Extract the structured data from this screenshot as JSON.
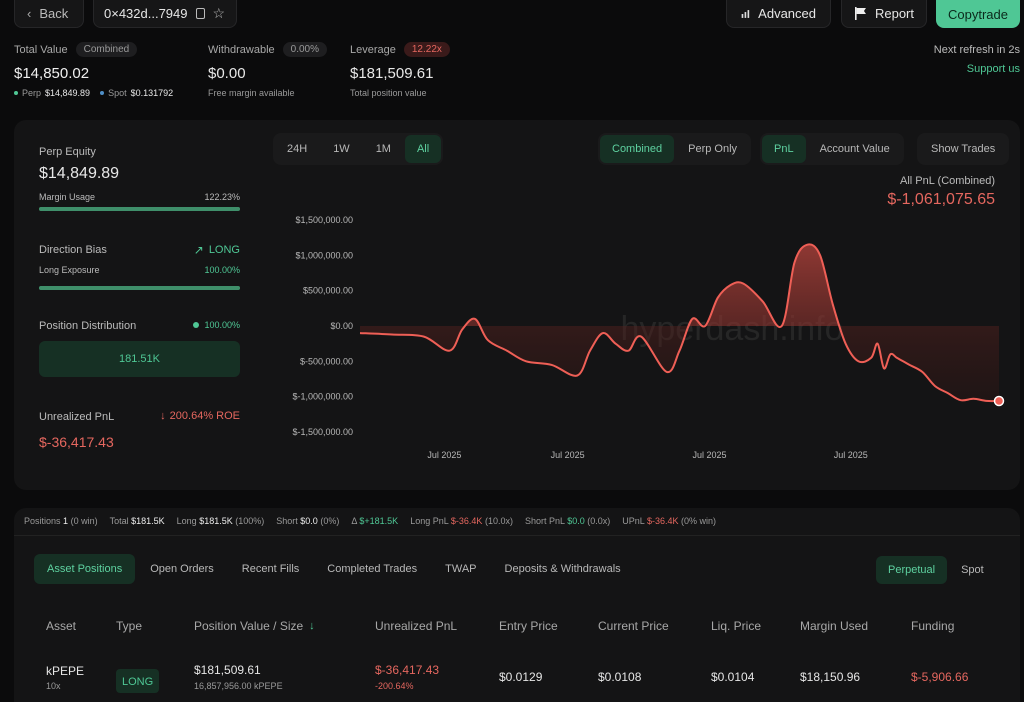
{
  "topbar": {
    "back_label": "Back",
    "address": "0×432d...7949",
    "advanced_label": "Advanced",
    "report_label": "Report",
    "copytrade_label": "Copytrade"
  },
  "summary": {
    "total_value_label": "Total Value",
    "total_value_badge": "Combined",
    "total_value": "$14,850.02",
    "perp_label": "Perp",
    "perp_value": "$14,849.89",
    "spot_label": "Spot",
    "spot_value": "$0.131792",
    "withdrawable_label": "Withdrawable",
    "withdrawable_badge": "0.00%",
    "withdrawable_value": "$0.00",
    "withdrawable_sub": "Free margin available",
    "leverage_label": "Leverage",
    "leverage_badge": "12.22x",
    "leverage_value": "$181,509.61",
    "leverage_sub": "Total position value",
    "refresh_text": "Next refresh in 2s",
    "support_label": "Support us"
  },
  "left_panel": {
    "perp_equity_label": "Perp Equity",
    "perp_equity_value": "$14,849.89",
    "margin_usage_label": "Margin Usage",
    "margin_usage_value": "122.23%",
    "direction_bias_label": "Direction Bias",
    "direction_bias_value": "LONG",
    "long_exposure_label": "Long Exposure",
    "long_exposure_value": "100.00%",
    "position_distribution_label": "Position Distribution",
    "position_distribution_value": "100.00%",
    "distribution_box_value": "181.51K",
    "unrealized_label": "Unrealized PnL",
    "roe_value": "200.64% ROE",
    "unrealized_value": "$-36,417.43",
    "margin_usage_fraction": 1.0,
    "long_exposure_fraction": 1.0
  },
  "chart_controls": {
    "ranges": [
      "24H",
      "1W",
      "1M",
      "All"
    ],
    "active_range": "All",
    "mode_tabs": [
      "Combined",
      "Perp Only"
    ],
    "metric_tabs": [
      "PnL",
      "Account Value"
    ],
    "show_trades_label": "Show Trades"
  },
  "chart_header": {
    "title": "All PnL (Combined)",
    "value": "$-1,061,075.65",
    "watermark": "hyperdash.info"
  },
  "chart_data": {
    "type": "area",
    "title": "All PnL (Combined)",
    "ylim": [
      -1500000,
      1500000
    ],
    "yticks": [
      1500000,
      1000000,
      500000,
      0,
      -500000,
      -1000000,
      -1500000
    ],
    "ytick_labels": [
      "$1,500,000.00",
      "$1,000,000.00",
      "$500,000.00",
      "$0.00",
      "$-500,000.00",
      "$-1,000,000.00",
      "$-1,500,000.00"
    ],
    "xtick_labels": [
      "Jul 2025",
      "Jul 2025",
      "Jul 2025",
      "Jul 2025"
    ],
    "xtick_positions": [
      0.132,
      0.325,
      0.547,
      0.768
    ],
    "x": [
      0,
      0.05,
      0.1,
      0.14,
      0.16,
      0.18,
      0.2,
      0.23,
      0.26,
      0.3,
      0.34,
      0.36,
      0.38,
      0.4,
      0.42,
      0.44,
      0.48,
      0.5,
      0.52,
      0.54,
      0.56,
      0.58,
      0.6,
      0.63,
      0.66,
      0.68,
      0.7,
      0.72,
      0.74,
      0.76,
      0.78,
      0.8,
      0.81,
      0.82,
      0.83,
      0.84,
      0.85,
      0.86,
      0.88,
      0.9,
      0.92,
      0.94,
      0.96,
      0.98,
      1.0
    ],
    "y": [
      -100000,
      -120000,
      -150000,
      -350000,
      -50000,
      100000,
      -200000,
      -350000,
      -500000,
      -550000,
      -700000,
      -350000,
      -100000,
      -250000,
      -350000,
      -150000,
      -650000,
      -350000,
      100000,
      0,
      400000,
      580000,
      600000,
      350000,
      0,
      900000,
      1150000,
      1000000,
      300000,
      -250000,
      -500000,
      -450000,
      -250000,
      -600000,
      -400000,
      -450000,
      -500000,
      -550000,
      -650000,
      -850000,
      -950000,
      -1050000,
      -1030000,
      -1060000,
      -1061075
    ]
  },
  "stats_row": {
    "positions_label": "Positions",
    "positions_value": "1",
    "positions_sub": "(0 win)",
    "total_label": "Total",
    "total_value": "$181.5K",
    "long_label": "Long",
    "long_value": "$181.5K",
    "long_sub": "(100%)",
    "short_label": "Short",
    "short_value": "$0.0",
    "short_sub": "(0%)",
    "delta_label": "Δ",
    "delta_value": "$+181.5K",
    "long_pnl_label": "Long PnL",
    "long_pnl_value": "$-36.4K",
    "long_pnl_sub": "(10.0x)",
    "short_pnl_label": "Short PnL",
    "short_pnl_value": "$0.0",
    "short_pnl_sub": "(0.0x)",
    "upnl_label": "UPnL",
    "upnl_value": "$-36.4K",
    "upnl_sub": "(0% win)"
  },
  "table_tabs": [
    "Asset Positions",
    "Open Orders",
    "Recent Fills",
    "Completed Trades",
    "TWAP",
    "Deposits & Withdrawals"
  ],
  "market_tabs": [
    "Perpetual",
    "Spot"
  ],
  "table": {
    "headers": [
      "Asset",
      "Type",
      "Position Value / Size",
      "Unrealized PnL",
      "Entry Price",
      "Current Price",
      "Liq. Price",
      "Margin Used",
      "Funding"
    ],
    "row": {
      "asset": "kPEPE",
      "leverage": "10x",
      "type": "LONG",
      "position_value": "$181,509.61",
      "position_size": "16,857,956.00 kPEPE",
      "unrealized": "$-36,417.43",
      "unrealized_pct": "-200.64%",
      "entry": "$0.0129",
      "current": "$0.0108",
      "liq": "$0.0104",
      "margin": "$18,150.96",
      "funding": "$-5,906.66"
    }
  },
  "colors": {
    "accent_green": "#4fc795",
    "accent_red": "#e5675f",
    "background": "#0b0b0c"
  }
}
